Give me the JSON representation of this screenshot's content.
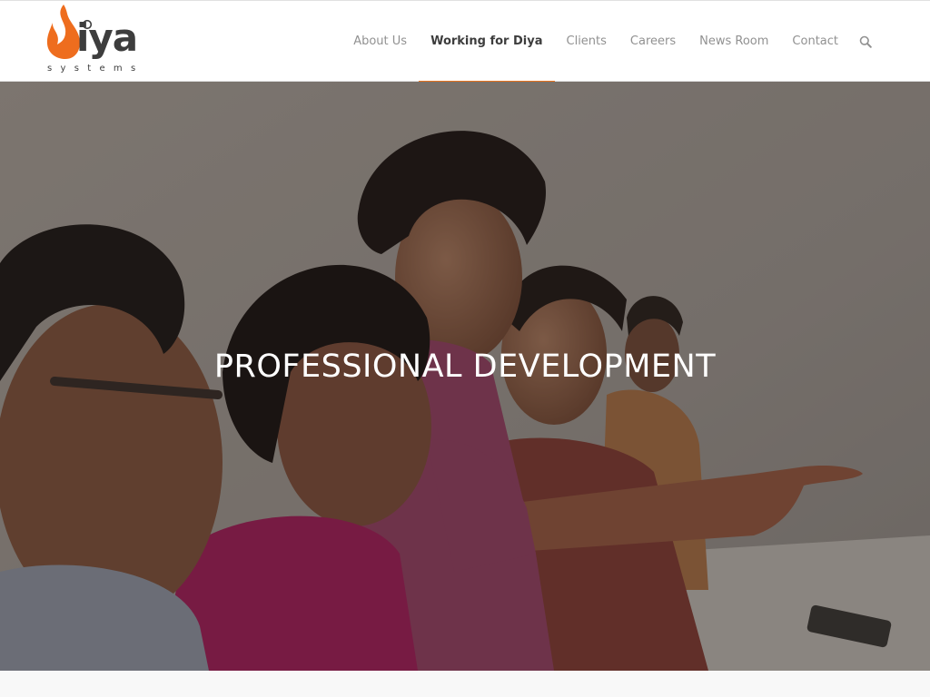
{
  "logo": {
    "wordmark": "iya",
    "tagline": "systems",
    "colors": {
      "flame": "#ee6d1e",
      "text": "#3d3d3d"
    }
  },
  "nav": {
    "items": [
      {
        "label": "About Us",
        "active": false
      },
      {
        "label": "Working for Diya",
        "active": true
      },
      {
        "label": "Clients",
        "active": false
      },
      {
        "label": "Careers",
        "active": false
      },
      {
        "label": "News Room",
        "active": false
      },
      {
        "label": "Contact",
        "active": false
      }
    ],
    "search_icon": "search-icon",
    "accent_color": "#e8731e"
  },
  "hero": {
    "title": "PROFESSIONAL DEVELOPMENT",
    "image": "photo of a team of office workers at computers, a woman pointing at a screen"
  }
}
